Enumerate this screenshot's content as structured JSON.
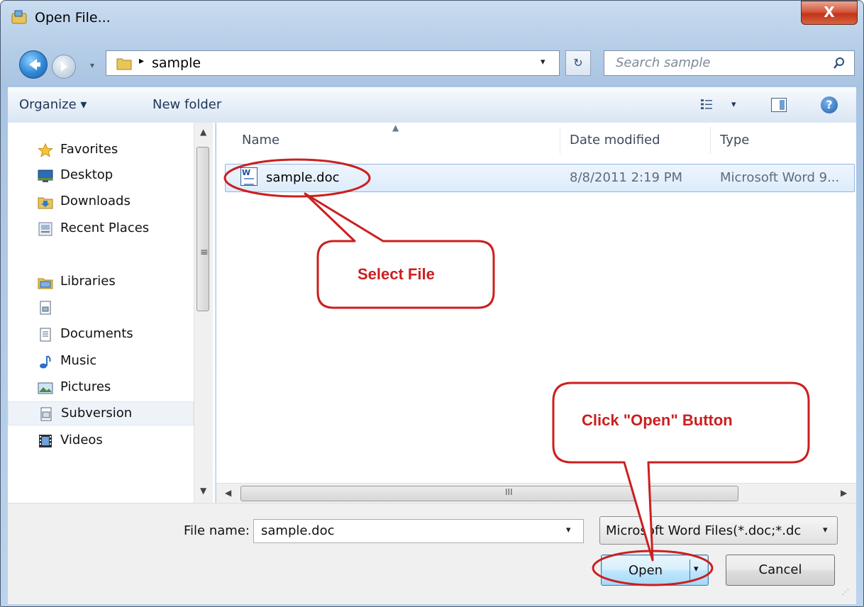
{
  "window": {
    "title": "Open File...",
    "close_label": "X"
  },
  "navigation": {
    "breadcrumb_separator": "▸",
    "current_folder": "sample",
    "search_placeholder": "Search sample",
    "dropdown_glyph": "▾",
    "refresh_glyph": "↻"
  },
  "toolbar": {
    "organize_label": "Organize ▾",
    "new_folder_label": "New folder",
    "views_dropdown_glyph": "▾",
    "help_label": "?"
  },
  "nav_pane": {
    "items": [
      {
        "label": "Favorites",
        "icon": "star-icon"
      },
      {
        "label": "Desktop",
        "icon": "desktop-icon"
      },
      {
        "label": "Downloads",
        "icon": "downloads-folder-icon"
      },
      {
        "label": "Recent Places",
        "icon": "recent-places-icon"
      },
      {
        "label": "Libraries",
        "icon": "libraries-icon"
      },
      {
        "label": "",
        "icon": "library-item-icon"
      },
      {
        "label": "Documents",
        "icon": "documents-icon"
      },
      {
        "label": "Music",
        "icon": "music-note-icon"
      },
      {
        "label": "Pictures",
        "icon": "pictures-icon"
      },
      {
        "label": "Subversion",
        "icon": "document-library-icon"
      },
      {
        "label": "Videos",
        "icon": "film-strip-icon"
      }
    ],
    "scroll_grip": "≡"
  },
  "file_list": {
    "columns": [
      "Name",
      "Date modified",
      "Type"
    ],
    "sort_indicator": "▲",
    "rows": [
      {
        "name": "sample.doc",
        "date_modified": "8/8/2011 2:19 PM",
        "type": "Microsoft Word 9...",
        "selected": true,
        "icon": "word-document-icon"
      }
    ],
    "hscroll_grip": "III"
  },
  "bottom": {
    "file_name_label": "File name:",
    "file_name_value": "sample.doc",
    "file_type_value": "Microsoft Word Files(*.doc;*.dc",
    "open_label": "Open",
    "cancel_label": "Cancel"
  },
  "annotations": {
    "select_file": "Select File",
    "click_open": "Click \"Open\" Button",
    "color": "#cc1f1f"
  },
  "colors": {
    "selection_fill": "#dcecfc",
    "selection_border": "#8fb6e3",
    "close_button": "#c2341a"
  }
}
